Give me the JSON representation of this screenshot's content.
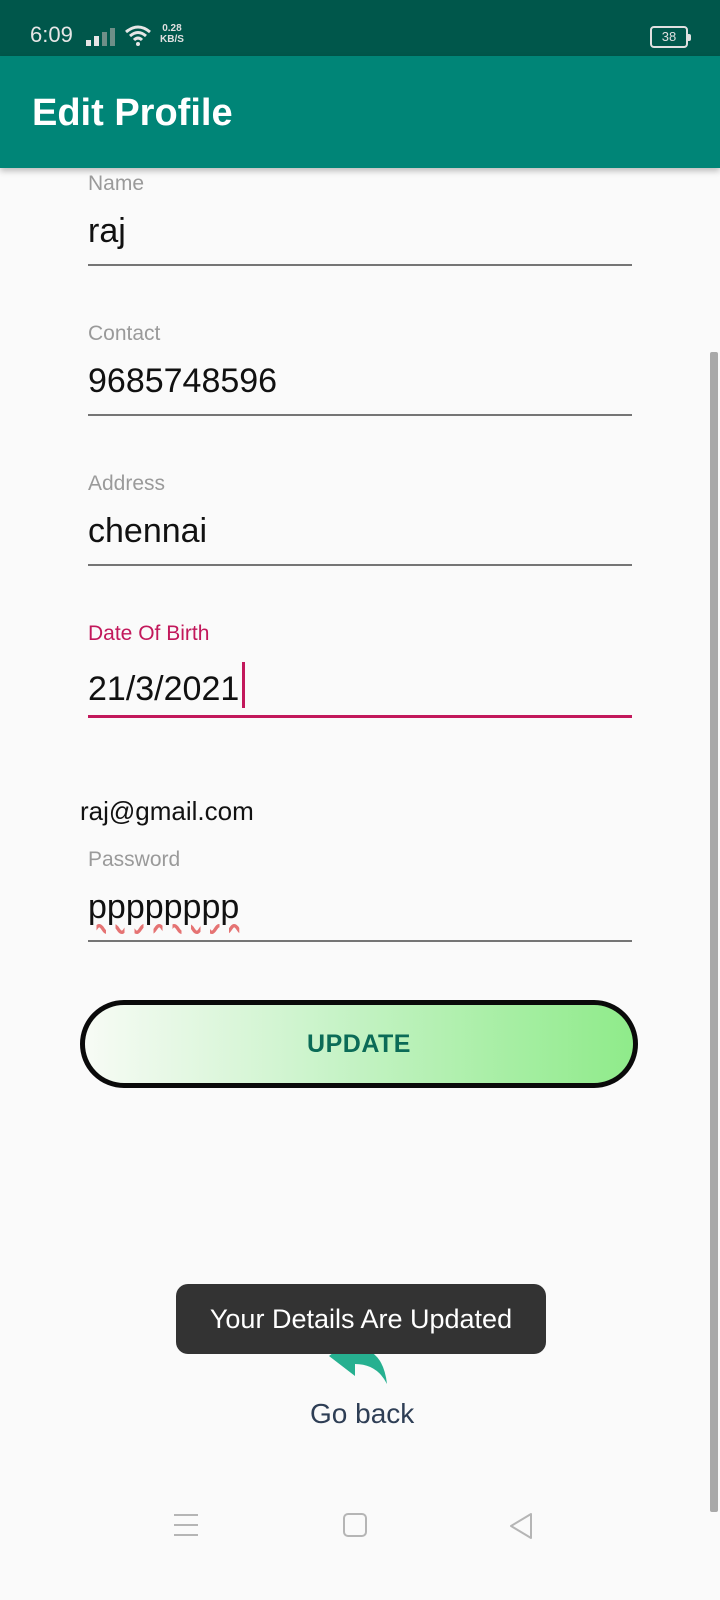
{
  "status_bar": {
    "time": "6:09",
    "net_speed_value": "0.28",
    "net_speed_unit": "KB/S",
    "battery": "38"
  },
  "app_bar": {
    "title": "Edit Profile"
  },
  "form": {
    "name": {
      "label": "Name",
      "value": "raj"
    },
    "contact": {
      "label": "Contact",
      "value": "9685748596"
    },
    "address": {
      "label": "Address",
      "value": "chennai"
    },
    "dob": {
      "label": "Date Of Birth",
      "value": "21/3/2021"
    },
    "email": "raj@gmail.com",
    "password": {
      "label": "Password",
      "value": "pppppppp"
    }
  },
  "update_button": {
    "label": "UPDATE"
  },
  "go_back": {
    "label": "Go back"
  },
  "toast": {
    "message": "Your Details Are Updated"
  },
  "icons": [
    "signal-icon",
    "wifi-icon",
    "battery-icon",
    "back-arrow-icon",
    "menu-icon",
    "home-icon",
    "back-icon"
  ],
  "colors": {
    "status_bar": "#00574b",
    "app_bar": "#008577",
    "accent": "#c2185b",
    "button_text": "#0b6b57",
    "toast_bg": "#333333"
  }
}
